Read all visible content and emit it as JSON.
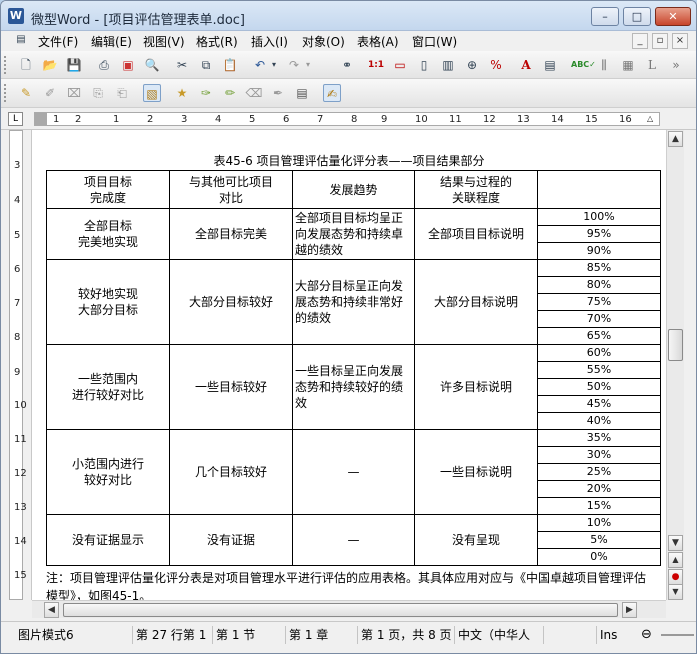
{
  "window": {
    "title": "微型Word - [项目评估管理表单.doc]",
    "app_icon": "W",
    "controls": {
      "minimize": "–",
      "maximize": "□",
      "close": "✕"
    }
  },
  "menu": {
    "items": [
      "文件(F)",
      "编辑(E)",
      "视图(V)",
      "格式(R)",
      "插入(I)",
      "对象(O)",
      "表格(A)",
      "窗口(W)"
    ],
    "mdi_controls": {
      "minimize": "_",
      "restore": "▫",
      "close": "×"
    }
  },
  "ruler": {
    "corner": "L",
    "numbers": [
      "1",
      "2",
      "1",
      "2",
      "3",
      "4",
      "5",
      "6",
      "7",
      "8",
      "9",
      "10",
      "11",
      "12",
      "13",
      "14",
      "15",
      "16",
      "17"
    ],
    "vnumbers": [
      "3",
      "4",
      "5",
      "6",
      "7",
      "8",
      "9",
      "10",
      "11",
      "12",
      "13",
      "14",
      "15"
    ]
  },
  "document": {
    "caption": "表45-6   项目管理评估量化评分表——项目结果部分",
    "headers": [
      [
        "项目目标",
        "完成度"
      ],
      [
        "与其他可比项目",
        "对比"
      ],
      [
        "发展趋势"
      ],
      [
        "结果与过程的",
        "关联程度"
      ],
      [
        ""
      ]
    ],
    "groups": [
      {
        "completion": [
          "全部目标",
          "完美地实现"
        ],
        "comparison": "全部目标完美",
        "trend": "全部项目目标均呈正向发展态势和持续卓越的绩效",
        "relation": "全部项目目标说明",
        "scores": [
          "100%",
          "95%",
          "90%"
        ]
      },
      {
        "completion": [
          "较好地实现",
          "大部分目标"
        ],
        "comparison": "大部分目标较好",
        "trend": "大部分目标呈正向发展态势和持续非常好的绩效",
        "relation": "大部分目标说明",
        "scores": [
          "85%",
          "80%",
          "75%",
          "70%",
          "65%"
        ]
      },
      {
        "completion": [
          "一些范围内",
          "进行较好对比"
        ],
        "comparison": "一些目标较好",
        "trend": "一些目标呈正向发展态势和持续较好的绩效",
        "relation": "许多目标说明",
        "scores": [
          "60%",
          "55%",
          "50%",
          "45%",
          "40%"
        ]
      },
      {
        "completion": [
          "小范围内进行",
          "较好对比"
        ],
        "comparison": "几个目标较好",
        "trend": "—",
        "relation": "一些目标说明",
        "scores": [
          "35%",
          "30%",
          "25%",
          "20%",
          "15%"
        ]
      },
      {
        "completion": [
          "没有证据显示"
        ],
        "comparison": "没有证据",
        "trend": "—",
        "relation": "没有呈现",
        "scores": [
          "10%",
          "5%",
          "0%"
        ]
      }
    ],
    "note": "注：项目管理评估量化评分表是对项目管理水平进行评估的应用表格。其具体应用对应与《中国卓越项目管理评估模型》，如图45-1。"
  },
  "status": {
    "mode": "图片模式6",
    "position": "第 27 行第 1",
    "section": "第 1 节",
    "chapter": "第 1 章",
    "page": "第 1 页，共 8 页",
    "language": "中文（中华人",
    "ins": "Ins"
  },
  "colors": {
    "title_bar": "#c4d7ee",
    "close_button": "#c7452c",
    "page": "#ffffff"
  }
}
